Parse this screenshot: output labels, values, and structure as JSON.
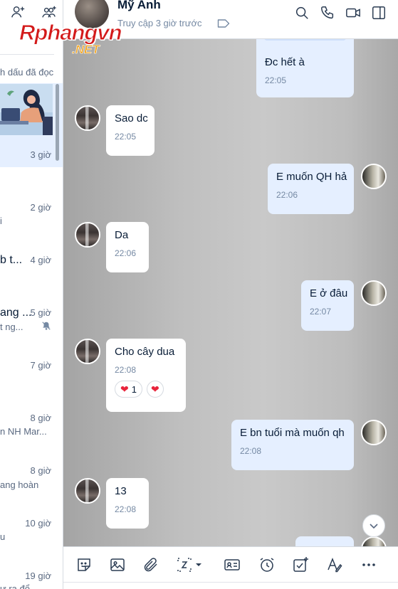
{
  "sidebar": {
    "mark_read": "h dấu đã đọc",
    "items": [
      {
        "time": "3 giờ",
        "title": "",
        "snippet": ""
      },
      {
        "time": "2 giờ",
        "title": "",
        "snippet": "i"
      },
      {
        "time": "4 giờ",
        "title": "b t...",
        "snippet": ""
      },
      {
        "time": "5 giờ",
        "title": "ang ...",
        "snippet": "t ng..."
      },
      {
        "time": "7 giờ",
        "title": "",
        "snippet": ""
      },
      {
        "time": "8 giờ",
        "title": "",
        "snippet": "n NH Mar..."
      },
      {
        "time": "8 giờ",
        "title": "",
        "snippet": "ang hoàn"
      },
      {
        "time": "10 giờ",
        "title": "",
        "snippet": "u"
      },
      {
        "time": "19 giờ",
        "title": "",
        "snippet": "ư ra đổ"
      }
    ]
  },
  "watermark": {
    "main": "Rphangvn",
    "sub": ".NET"
  },
  "header": {
    "name": "Mỹ Anh",
    "status": "Truy cập 3 giờ trước"
  },
  "messages": [
    {
      "dir": "out",
      "text": "Đc hết à",
      "time": "22:05"
    },
    {
      "dir": "in",
      "text": "Sao dc",
      "time": "22:05"
    },
    {
      "dir": "out",
      "text": "E muốn QH hả",
      "time": "22:06"
    },
    {
      "dir": "in",
      "text": "Da",
      "time": "22:06"
    },
    {
      "dir": "out",
      "text": "E ở đâu",
      "time": "22:07"
    },
    {
      "dir": "in",
      "text": "Cho cây dua",
      "time": "22:08",
      "reactions": [
        {
          "icon": "heart",
          "count": "1"
        },
        {
          "icon": "heart",
          "count": ""
        }
      ]
    },
    {
      "dir": "out",
      "text": "E bn tuổi mà muốn qh",
      "time": "22:08"
    },
    {
      "dir": "in",
      "text": "13",
      "time": "22:08"
    }
  ],
  "toolbar": {
    "icons": [
      "sticker-icon",
      "image-icon",
      "attachment-icon",
      "screenshot-icon",
      "contact-card-icon",
      "reminder-icon",
      "task-icon",
      "format-text-icon",
      "more-icon"
    ]
  },
  "colors": {
    "bubble_out": "#e5efff",
    "bubble_in": "#ffffff",
    "time_text": "#7589a3",
    "heart": "#e8243c"
  }
}
